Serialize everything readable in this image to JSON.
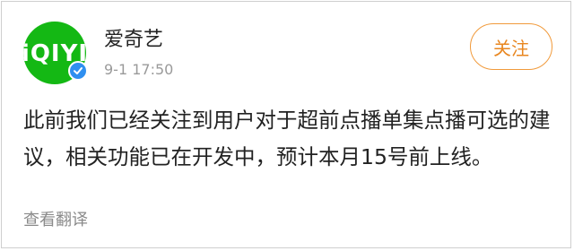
{
  "post": {
    "avatar": {
      "logo_text": "iQIYI",
      "brand_color": "#14b814",
      "badge_icon": "verified-check-icon",
      "badge_color": "#2f8ff0"
    },
    "username": "爱奇艺",
    "timestamp": "9-1 17:50",
    "follow_label": "关注",
    "follow_color": "#e8861f",
    "body_text": "此前我们已经关注到用户对于超前点播单集点播可选的建议，相关功能已在开发中，预计本月15号前上线。",
    "translate_label": "查看翻译"
  }
}
